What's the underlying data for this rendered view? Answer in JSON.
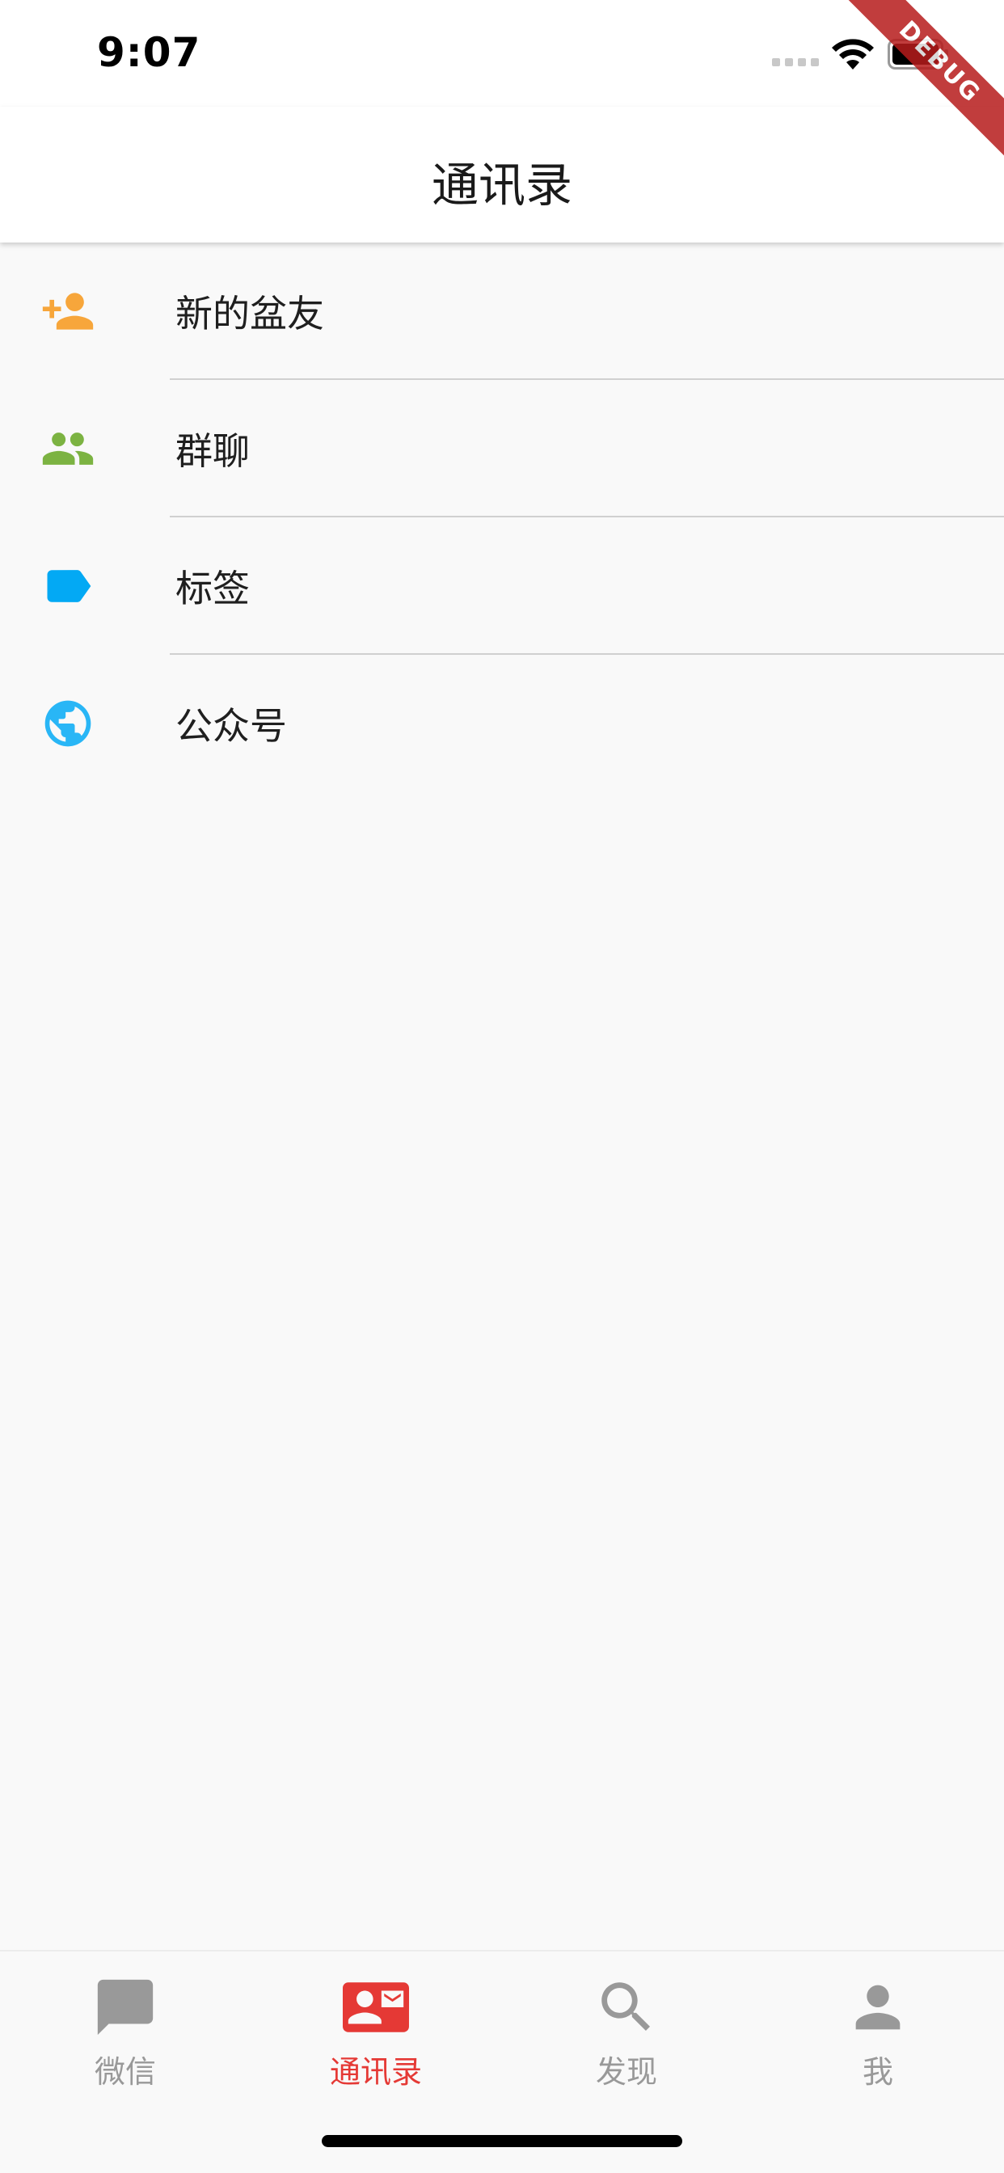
{
  "status_bar": {
    "time": "9:07"
  },
  "debug_banner": {
    "label": "DEBUG",
    "color": "#b71c1c"
  },
  "app_bar": {
    "title": "通讯录"
  },
  "contacts_menu": {
    "items": [
      {
        "label": "新的盆友",
        "icon": "person-add-icon",
        "icon_color": "#f7a63b"
      },
      {
        "label": "群聊",
        "icon": "group-icon",
        "icon_color": "#7cb342"
      },
      {
        "label": "标签",
        "icon": "label-tag-icon",
        "icon_color": "#03a9f4"
      },
      {
        "label": "公众号",
        "icon": "globe-icon",
        "icon_color": "#29b6f6"
      }
    ]
  },
  "tab_bar": {
    "active_color": "#e53935",
    "inactive_color": "#999999",
    "tabs": [
      {
        "label": "微信",
        "icon": "chat-bubble-icon",
        "active": false
      },
      {
        "label": "通讯录",
        "icon": "contact-mail-icon",
        "active": true
      },
      {
        "label": "发现",
        "icon": "search-icon",
        "active": false
      },
      {
        "label": "我",
        "icon": "person-icon",
        "active": false
      }
    ]
  }
}
